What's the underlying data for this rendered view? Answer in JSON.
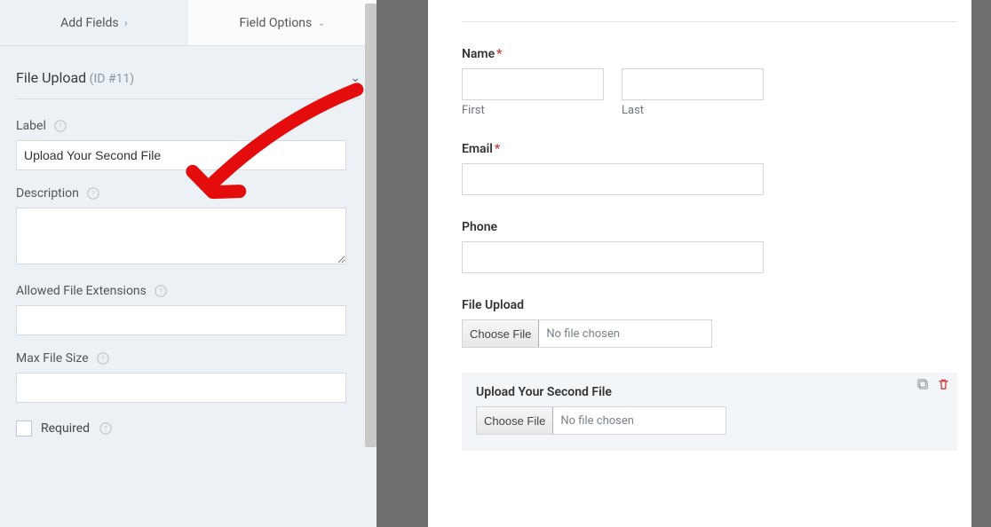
{
  "sidebar": {
    "tabs": {
      "add_fields": "Add Fields",
      "field_options": "Field Options"
    },
    "field_header": {
      "title": "File Upload",
      "id_text": "(ID #11)"
    },
    "label": {
      "lbl": "Label",
      "value": "Upload Your Second File"
    },
    "description": {
      "lbl": "Description",
      "value": ""
    },
    "allowed_ext": {
      "lbl": "Allowed File Extensions",
      "value": ""
    },
    "max_size": {
      "lbl": "Max File Size",
      "value": ""
    },
    "required": {
      "lbl": "Required"
    }
  },
  "preview": {
    "name": {
      "lbl": "Name",
      "first": "First",
      "last": "Last"
    },
    "email": {
      "lbl": "Email"
    },
    "phone": {
      "lbl": "Phone"
    },
    "file1": {
      "lbl": "File Upload",
      "btn": "Choose File",
      "status": "No file chosen"
    },
    "file2": {
      "lbl": "Upload Your Second File",
      "btn": "Choose File",
      "status": "No file chosen"
    }
  }
}
